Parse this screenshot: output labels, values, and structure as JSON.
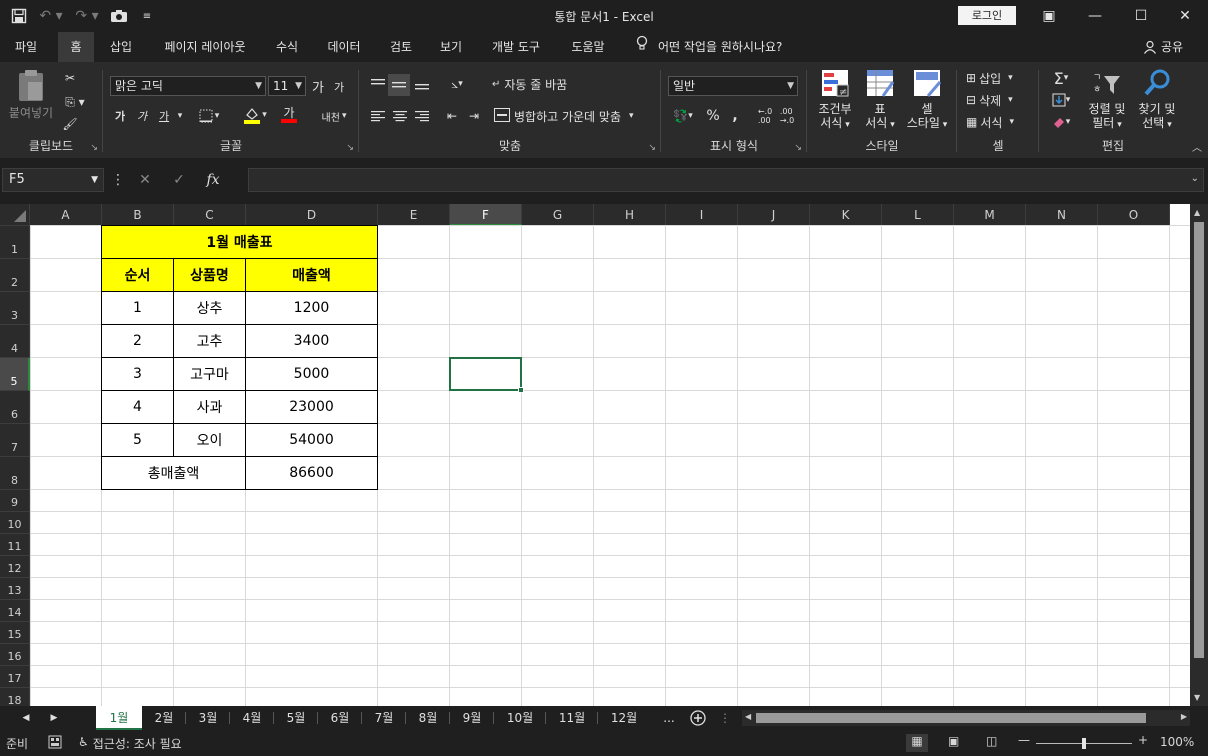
{
  "window": {
    "title": "통합 문서1  -  Excel",
    "login": "로그인",
    "controls": [
      "▣",
      "—",
      "☐",
      "✕"
    ]
  },
  "ribbon_tabs": [
    "파일",
    "홈",
    "삽입",
    "페이지 레이아웃",
    "수식",
    "데이터",
    "검토",
    "보기",
    "개발 도구",
    "도움말"
  ],
  "tell_me": "어떤 작업을 원하시나요?",
  "share": "공유",
  "clipboard": {
    "paste": "붙여넣기",
    "label": "클립보드"
  },
  "font": {
    "name": "맑은 고딕",
    "size": "11",
    "grow": "가",
    "shrink": "가",
    "bold": "가",
    "italic": "가",
    "underline": "가",
    "font_color": "가",
    "phonetic": "내천",
    "label": "글꼴",
    "fill_color": "#ffff00",
    "text_color": "#ff0000"
  },
  "alignment": {
    "wrap": "자동 줄 바꿈",
    "merge": "병합하고 가운데 맞춤",
    "label": "맞춤"
  },
  "number": {
    "format": "일반",
    "percent": "%",
    "comma": ",",
    "label": "표시 형식"
  },
  "styles": {
    "conditional_1": "조건부",
    "conditional_2": "서식",
    "table_1": "표",
    "table_2": "서식",
    "cell_1": "셀",
    "cell_2": "스타일",
    "label": "스타일"
  },
  "cells": {
    "insert": "삽입",
    "delete": "삭제",
    "format": "서식",
    "label": "셀"
  },
  "editing": {
    "sort_1": "정렬 및",
    "sort_2": "필터",
    "find_1": "찾기 및",
    "find_2": "선택",
    "label": "편집"
  },
  "formula_bar": {
    "name_box": "F5",
    "fx": "fx",
    "value": ""
  },
  "columns": [
    "A",
    "B",
    "C",
    "D",
    "E",
    "F",
    "G",
    "H",
    "I",
    "J",
    "K",
    "L",
    "M",
    "N",
    "O"
  ],
  "rows": [
    "1",
    "2",
    "3",
    "4",
    "5",
    "6",
    "7",
    "8",
    "9",
    "10",
    "11",
    "12",
    "13",
    "14",
    "15",
    "16",
    "17",
    "18"
  ],
  "selected_cell": "F5",
  "table": {
    "title": "1월 매출표",
    "headers": [
      "순서",
      "상품명",
      "매출액"
    ],
    "rows": [
      [
        "1",
        "상추",
        "1200"
      ],
      [
        "2",
        "고추",
        "3400"
      ],
      [
        "3",
        "고구마",
        "5000"
      ],
      [
        "4",
        "사과",
        "23000"
      ],
      [
        "5",
        "오이",
        "54000"
      ]
    ],
    "total_label": "총매출액",
    "total_value": "86600",
    "header_fill": "#ffff00"
  },
  "sheets": [
    "1월",
    "2월",
    "3월",
    "4월",
    "5월",
    "6월",
    "7월",
    "8월",
    "9월",
    "10월",
    "11월",
    "12월"
  ],
  "more_sheets": "...",
  "status": {
    "ready": "준비",
    "accessibility": "접근성: 조사 필요",
    "zoom": "100%"
  },
  "accent": "#217346"
}
